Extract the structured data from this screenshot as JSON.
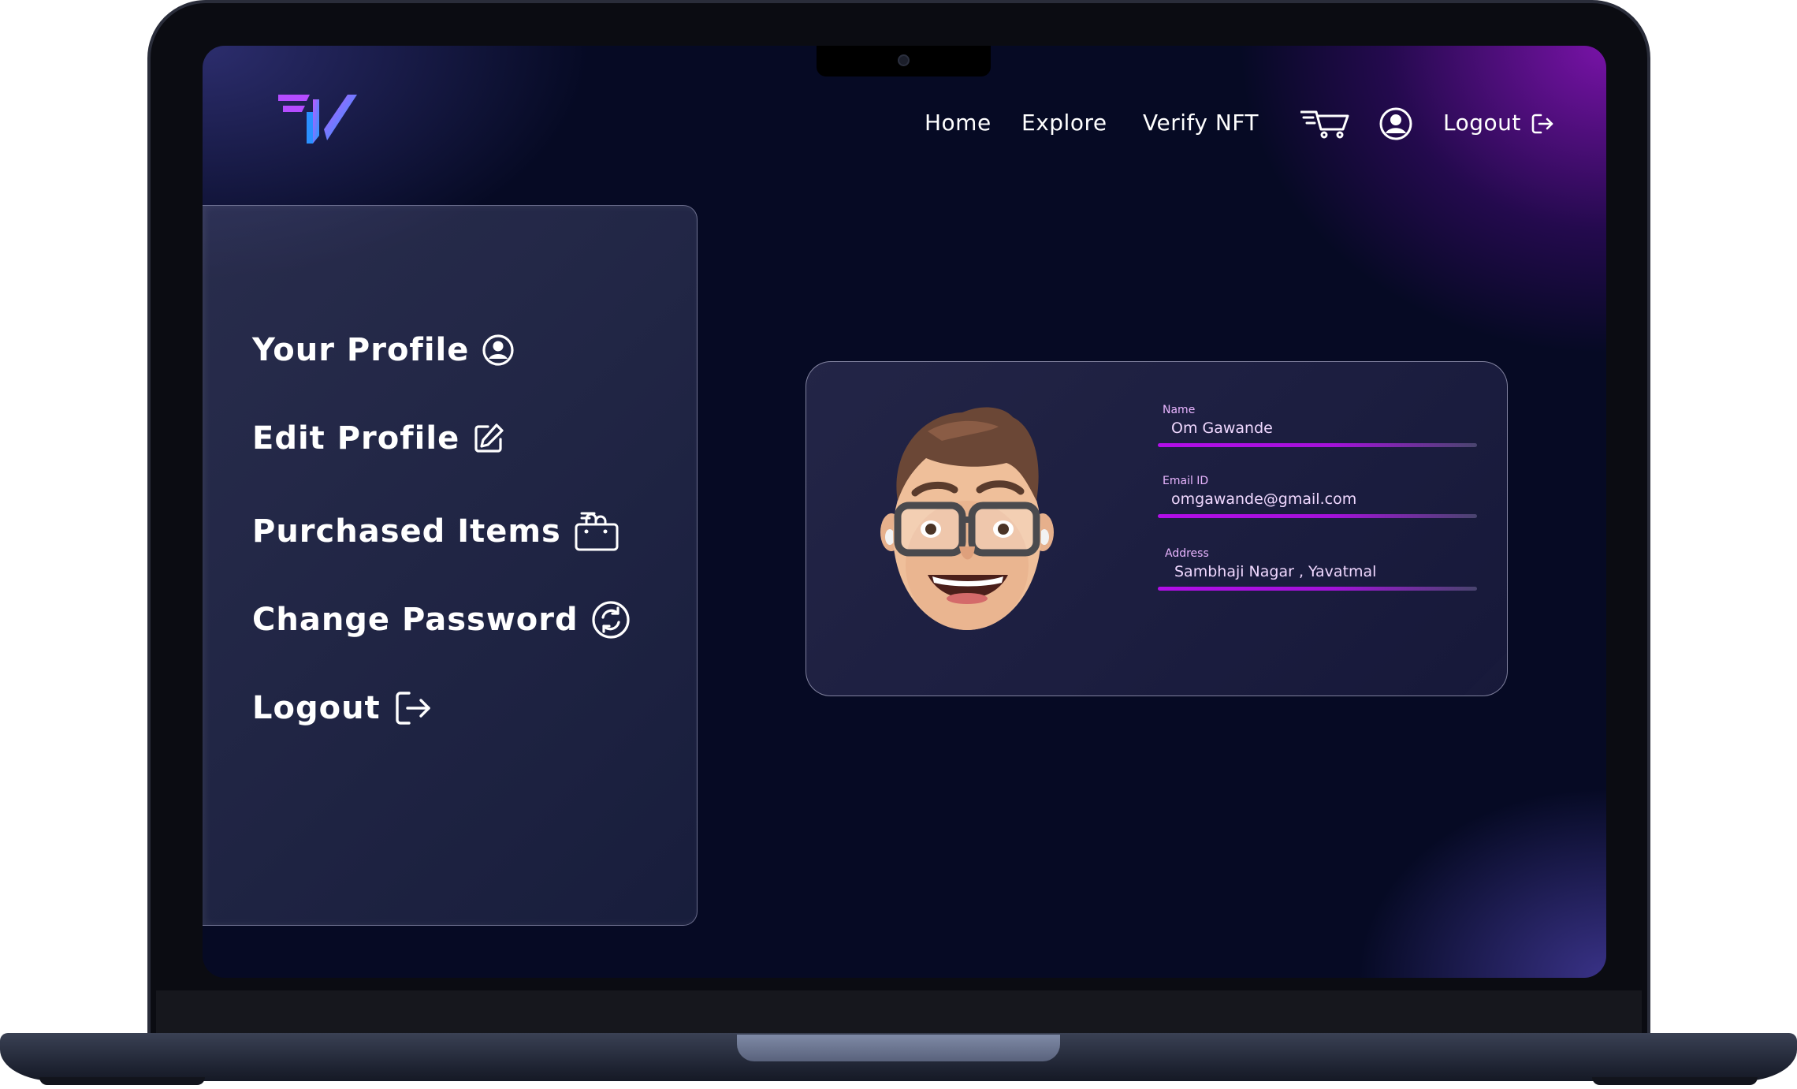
{
  "nav": {
    "home": "Home",
    "explore": "Explore",
    "verify_nft": "Verify NFT",
    "logout": "Logout",
    "cart_icon": "cart-icon",
    "account_icon": "user-circle-icon",
    "logout_icon": "logout-icon"
  },
  "sidebar": {
    "items": [
      {
        "label": "Your Profile",
        "icon": "user-circle-icon"
      },
      {
        "label": "Edit Profile",
        "icon": "edit-icon"
      },
      {
        "label": "Purchased Items",
        "icon": "shopping-bag-icon"
      },
      {
        "label": "Change Password",
        "icon": "refresh-icon"
      },
      {
        "label": "Logout",
        "icon": "logout-icon"
      }
    ]
  },
  "profile": {
    "avatar": "memoji-avatar",
    "name_label": "Name",
    "name": "Om Gawande",
    "email_label": "Email ID",
    "email": "omgawande@gmail.com",
    "address_label": "Address",
    "address": "Sambhaji Nagar , Yavatmal"
  },
  "colors": {
    "background": "#060a24",
    "accent": "#b20ee8",
    "field_text": "#f0d8ff",
    "logo_gradient_start": "#b44cff",
    "logo_gradient_end": "#1ea0ff"
  }
}
